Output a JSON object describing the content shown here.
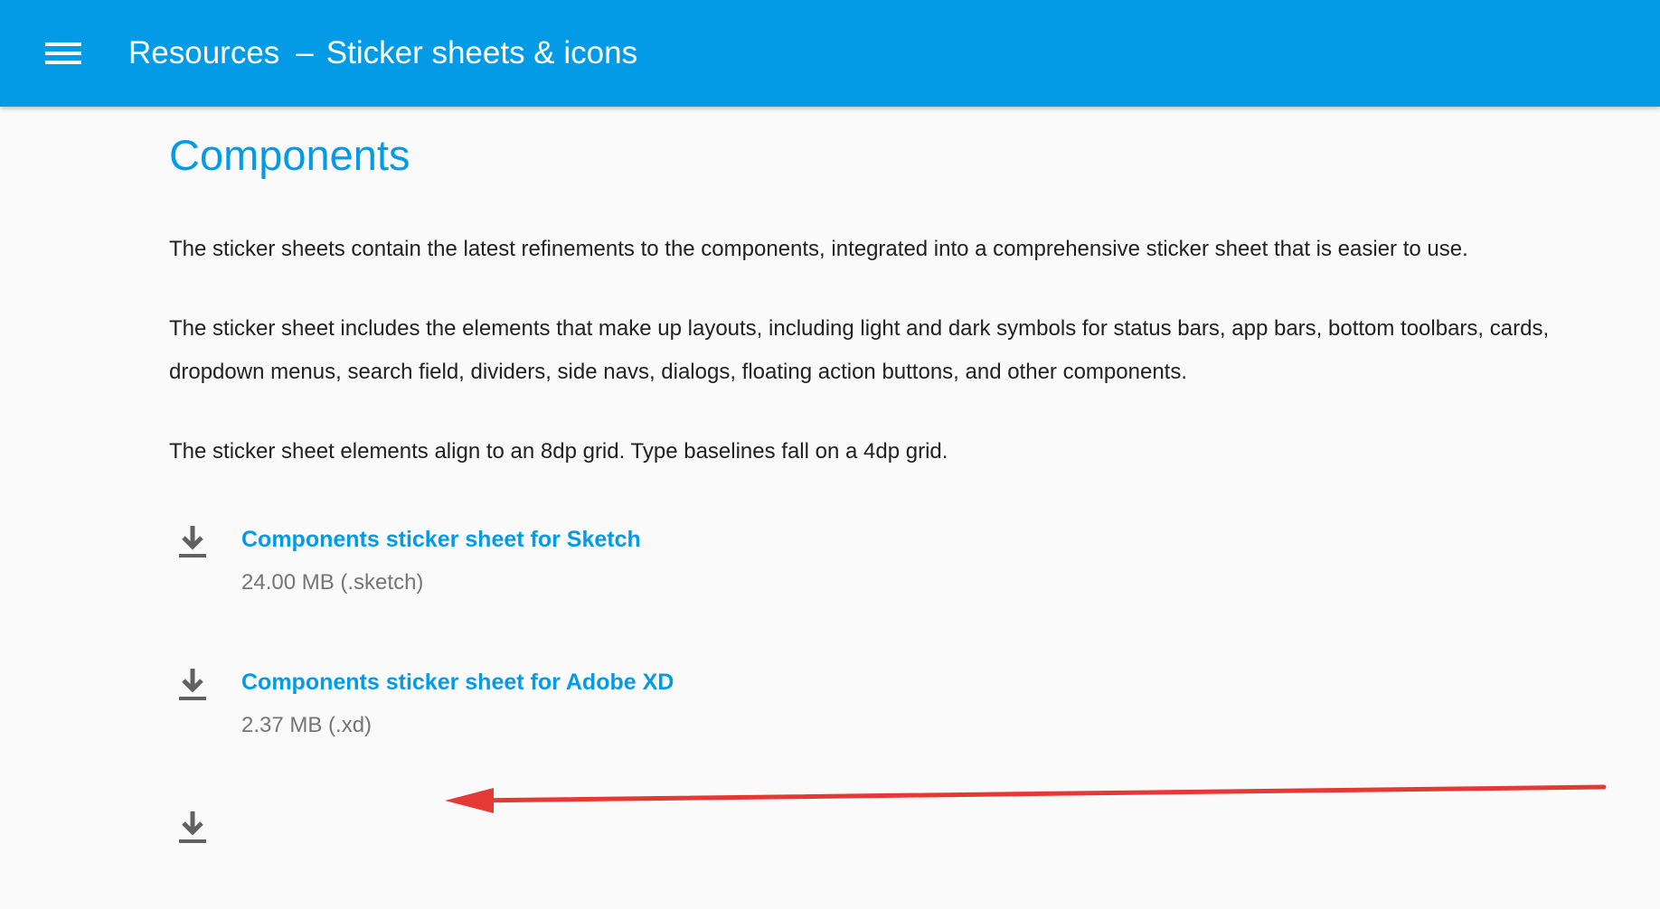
{
  "appbar": {
    "menu_icon": "hamburger-menu-icon",
    "title_section": "Resources",
    "title_separator": "–",
    "title_page": "Sticker sheets & icons",
    "background_color": "#039be5"
  },
  "main": {
    "heading": "Components",
    "paragraphs": [
      "The sticker sheets contain the latest refinements to the components, integrated into a comprehensive sticker sheet that is easier to use.",
      "The sticker sheet includes the elements that make up layouts, including light and dark symbols for status bars, app bars, bottom toolbars, cards, dropdown menus, search field, dividers, side navs, dialogs, floating action buttons, and other components.",
      "The sticker sheet elements align to an 8dp grid. Type baselines fall on a 4dp grid."
    ],
    "downloads": [
      {
        "icon": "download-icon",
        "label": "Components sticker sheet for Sketch",
        "size": "24.00 MB (.sketch)"
      },
      {
        "icon": "download-icon",
        "label": "Components sticker sheet for Adobe XD",
        "size": "2.37 MB (.xd)"
      },
      {
        "icon": "download-icon",
        "label": "",
        "size": ""
      }
    ],
    "accent_color": "#039be5"
  },
  "annotation": {
    "type": "red-arrow",
    "color": "#e53935",
    "points_to": "2.37 MB (.xd)"
  }
}
